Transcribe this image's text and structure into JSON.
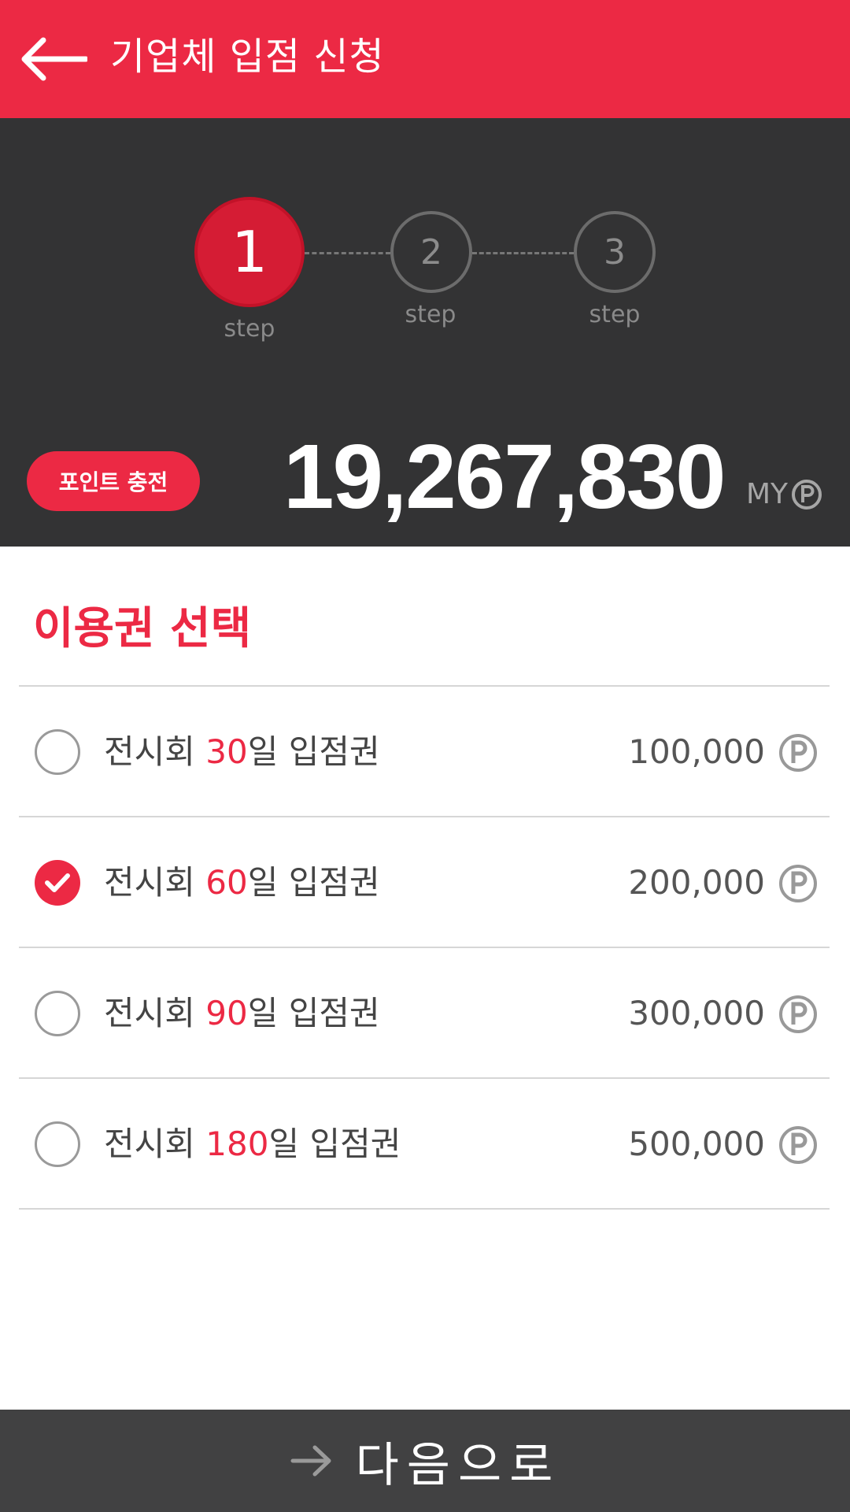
{
  "header": {
    "title": "기업체 입점 신청",
    "back_icon": "arrow-left-icon"
  },
  "steps": [
    {
      "number": "1",
      "label": "step",
      "active": true
    },
    {
      "number": "2",
      "label": "step",
      "active": false
    },
    {
      "number": "3",
      "label": "step",
      "active": false
    }
  ],
  "points": {
    "charge_label": "포인트 충전",
    "balance": "19,267,830",
    "unit": "MY"
  },
  "section": {
    "title": "이용권 선택"
  },
  "options": [
    {
      "prefix": "전시회 ",
      "days": "30",
      "suffix": "일 입점권",
      "price": "100,000",
      "selected": false
    },
    {
      "prefix": "전시회 ",
      "days": "60",
      "suffix": "일 입점권",
      "price": "200,000",
      "selected": true
    },
    {
      "prefix": "전시회 ",
      "days": "90",
      "suffix": "일 입점권",
      "price": "300,000",
      "selected": false
    },
    {
      "prefix": "전시회 ",
      "days": "180",
      "suffix": "일 입점권",
      "price": "500,000",
      "selected": false
    }
  ],
  "footer": {
    "next_label": "다음으로",
    "next_icon": "arrow-right-icon"
  },
  "colors": {
    "accent": "#ec2944",
    "panel": "#333334",
    "footer": "#414142"
  }
}
